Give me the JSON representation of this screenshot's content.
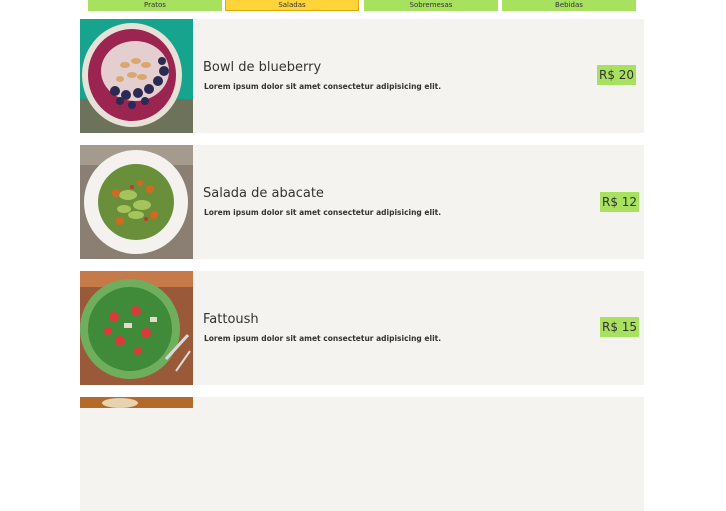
{
  "tabs": [
    {
      "label": "Pratos"
    },
    {
      "label": "Saladas"
    },
    {
      "label": "Sobremesas"
    },
    {
      "label": "Bebidas"
    }
  ],
  "items": [
    {
      "name": "Bowl de blueberry",
      "description": "Lorem ipsum dolor sit amet consectetur adipisicing elit.",
      "price": "R$ 20"
    },
    {
      "name": "Salada de abacate",
      "description": "Lorem ipsum dolor sit amet consectetur adipisicing elit.",
      "price": "R$ 12"
    },
    {
      "name": "Fattoush",
      "description": "Lorem ipsum dolor sit amet consectetur adipisicing elit.",
      "price": "R$ 15"
    }
  ],
  "colors": {
    "tab": "#a8e05f",
    "tab_active": "#ffd43a",
    "card": "#f5f3ef",
    "price_badge": "#a8e05f"
  }
}
